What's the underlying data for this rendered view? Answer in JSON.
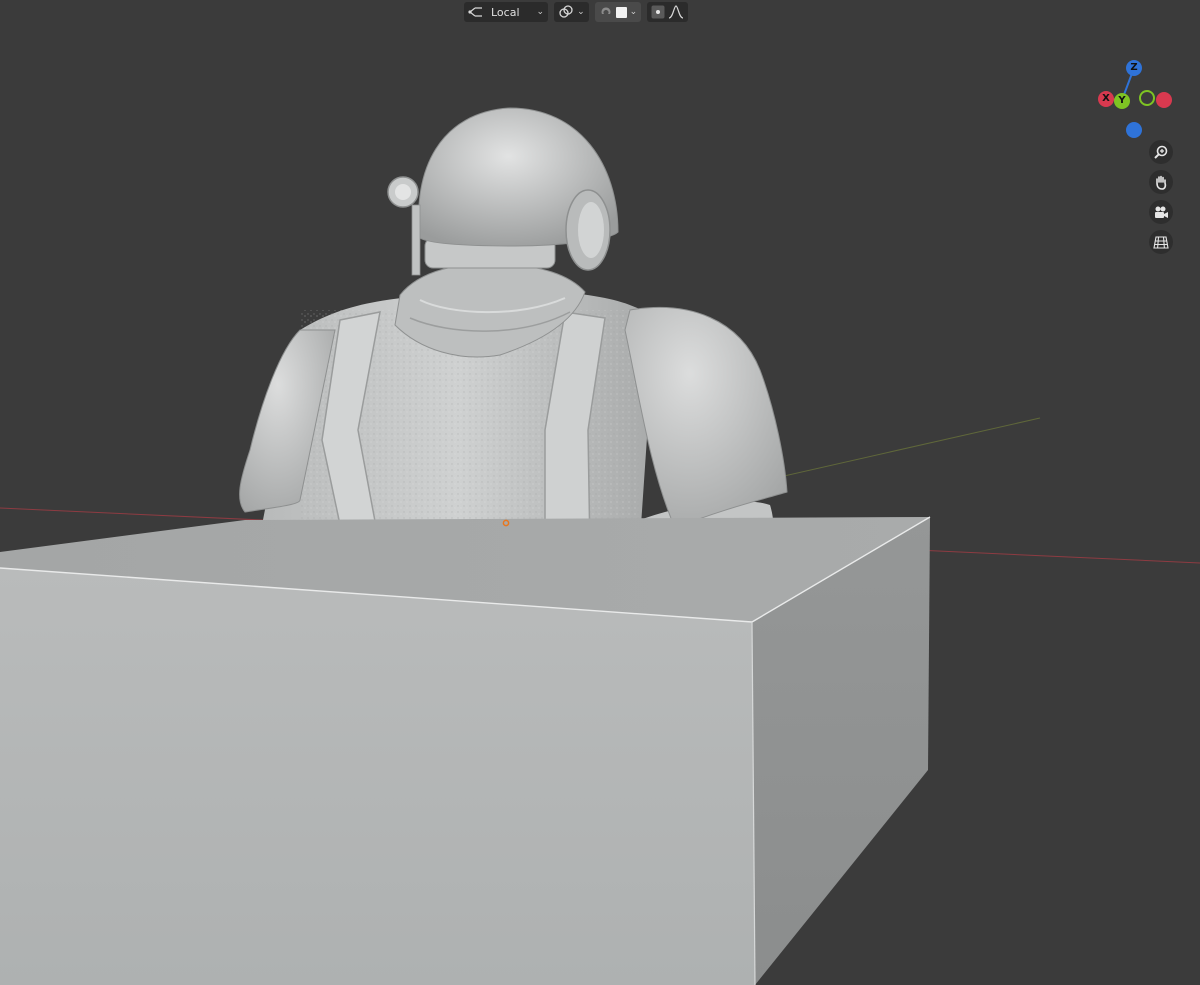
{
  "header": {
    "transform_orientation": {
      "label": "Local",
      "icon": "transform-orientation-icon"
    },
    "pivot": {
      "icon": "link-chain-icon"
    },
    "snap": {
      "icon": "magnet-icon"
    },
    "snap_target": {
      "icon": "snap-square-icon"
    },
    "proportional_editing": {
      "icon": "proportional-editing-icon"
    },
    "falloff": {
      "icon": "falloff-curve-icon"
    }
  },
  "gizmo": {
    "axes": [
      {
        "label": "Z",
        "color": "#2f73d8"
      },
      {
        "label": "X",
        "color": "#d8394f"
      },
      {
        "label": "Y",
        "color": "#7ec423"
      }
    ],
    "negative_colors": {
      "x": "#d8394f",
      "y": "#7ec423",
      "z": "#2f73d8"
    }
  },
  "nav_buttons": [
    {
      "icon": "zoom-icon"
    },
    {
      "icon": "pan-hand-icon"
    },
    {
      "icon": "camera-icon"
    },
    {
      "icon": "ortho-grid-icon"
    }
  ],
  "colors": {
    "background": "#3b3b3b",
    "x_axis_line": "#a23c44",
    "y_axis_line": "#6f7a3a",
    "model": "#c9cbcc",
    "box_top": "#a9abab",
    "box_front": "#b3b6b6",
    "box_side": "#909393"
  }
}
